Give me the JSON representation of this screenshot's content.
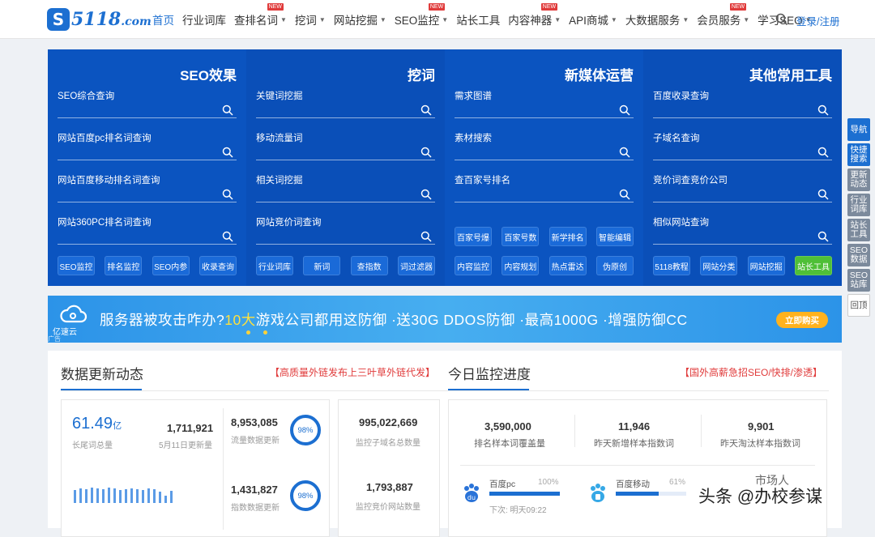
{
  "header": {
    "logo_text": "5118",
    "logo_domain": ".com",
    "menu": [
      {
        "label": "首页",
        "active": true,
        "caret": false,
        "new": false
      },
      {
        "label": "行业词库",
        "active": false,
        "caret": false,
        "new": false
      },
      {
        "label": "查排名词",
        "active": false,
        "caret": true,
        "new": true
      },
      {
        "label": "挖词",
        "active": false,
        "caret": true,
        "new": false
      },
      {
        "label": "网站挖掘",
        "active": false,
        "caret": true,
        "new": false
      },
      {
        "label": "SEO监控",
        "active": false,
        "caret": true,
        "new": true
      },
      {
        "label": "站长工具",
        "active": false,
        "caret": false,
        "new": false
      },
      {
        "label": "内容神器",
        "active": false,
        "caret": true,
        "new": true
      },
      {
        "label": "API商城",
        "active": false,
        "caret": true,
        "new": false
      },
      {
        "label": "大数据服务",
        "active": false,
        "caret": true,
        "new": false
      },
      {
        "label": "会员服务",
        "active": false,
        "caret": true,
        "new": true
      },
      {
        "label": "学习SEO",
        "active": false,
        "caret": true,
        "new": false
      }
    ],
    "new_badge": "NEW",
    "login": "登录/注册"
  },
  "panels": [
    {
      "title": "SEO效果",
      "fields": [
        "SEO综合查询",
        "网站百度pc排名词查询",
        "网站百度移动排名词查询",
        "网站360PC排名词查询"
      ],
      "upper_buttons": [],
      "buttons": [
        "SEO监控",
        "排名监控",
        "SEO内参",
        "收录查询"
      ]
    },
    {
      "title": "挖词",
      "fields": [
        "关键词挖掘",
        "移动流量词",
        "相关词挖掘",
        "网站竞价词查询"
      ],
      "upper_buttons": [],
      "buttons": [
        "行业词库",
        "新词",
        "查指数",
        "词过滤器"
      ]
    },
    {
      "title": "新媒体运营",
      "fields": [
        "需求图谱",
        "素材搜索",
        "查百家号排名"
      ],
      "upper_buttons": [
        "百家号爆",
        "百家号数",
        "新学排名",
        "智能编辑"
      ],
      "buttons": [
        "内容监控",
        "内容规划",
        "热点雷达",
        "伪原创"
      ]
    },
    {
      "title": "其他常用工具",
      "fields": [
        "百度收录查询",
        "子域名查询",
        "竞价词查竞价公司",
        "相似网站查询"
      ],
      "upper_buttons": [],
      "buttons": [
        "5118教程",
        "网站分类",
        "网站挖掘",
        "站长工具"
      ]
    }
  ],
  "sidenav": [
    "导航",
    "快捷搜索",
    "更新动态",
    "行业词库",
    "站长工具",
    "SEO数据",
    "SEO站库",
    "回顶"
  ],
  "banner": {
    "brand": "亿速云",
    "ad": "广告",
    "text_a": "服务器被攻击咋办?",
    "text_hl": "10大",
    "text_b": "游戏公司都用这防御  ·送30G DDOS防御 ·最高1000G ·增强防御CC",
    "cta": "立即购买"
  },
  "stats": {
    "left_title": "数据更新动态",
    "left_link": "【高质量外链发布上三叶草外链代发】",
    "right_title": "今日监控进度",
    "right_link": "【国外高薪急招SEO/快排/渗透】",
    "longtail_value": "61.49",
    "longtail_unit": "亿",
    "longtail_cap": "长尾词总量",
    "daily_value": "1,711,921",
    "daily_cap": "5月11日更新量",
    "flow_value": "8,953,085",
    "flow_cap": "流量数据更新",
    "flow_pct": "98%",
    "index_value": "1,431,827",
    "index_cap": "指数数据更新",
    "index_pct": "98%",
    "subdomain_value": "995,022,669",
    "subdomain_cap": "监控子域名总数量",
    "bid_value": "1,793,887",
    "bid_cap": "监控竞价网站数量",
    "m1_value": "3,590,000",
    "m1_cap": "排名样本词覆盖量",
    "m2_value": "11,946",
    "m2_cap": "昨天新增样本指数词",
    "m3_value": "9,901",
    "m3_cap": "昨天淘汰样本指数词",
    "pc_label": "百度pc",
    "pc_pct": "100%",
    "pc_progress": 1.0,
    "pc_next": "下次: 明天09:22",
    "mobile_label": "百度移动",
    "mobile_pct": "61%",
    "mobile_progress": 0.61
  },
  "watermark": {
    "text": "头条 @办校参谋",
    "sub": "市场人"
  },
  "colors": {
    "brand": "#1c6fd1",
    "panel": "#0b54c0",
    "green": "#4fbf37",
    "red": "#e03b3b"
  }
}
